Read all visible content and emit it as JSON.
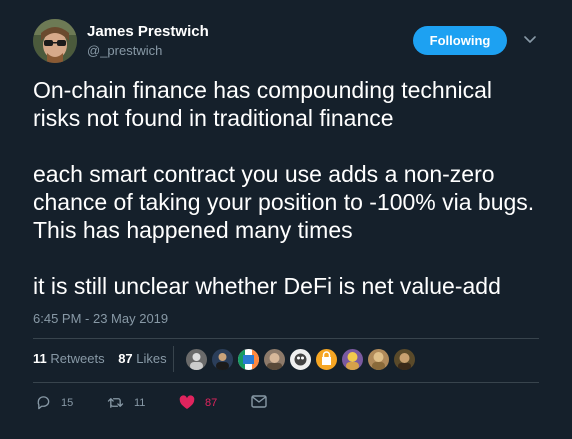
{
  "author": {
    "name": "James Prestwich",
    "handle": "@_prestwich"
  },
  "follow_label": "Following",
  "tweet": {
    "paragraphs": [
      "On-chain finance has compounding technical risks not found in traditional finance",
      "each smart contract you use adds a non-zero chance of taking your position to -100% via bugs. This has happened many times",
      "it is still unclear whether DeFi is net value-add"
    ],
    "timestamp": "6:45 PM - 23 May 2019"
  },
  "stats": {
    "retweets_count": "11",
    "retweets_label": "Retweets",
    "likes_count": "87",
    "likes_label": "Likes"
  },
  "actions": {
    "replies": "15",
    "retweets": "11",
    "likes": "87"
  },
  "colors": {
    "background": "#15202b",
    "accent": "#1da1f2",
    "like": "#e0245e",
    "muted": "#8899a6",
    "divider": "#38444d"
  },
  "icons": [
    "chevron-down-icon",
    "reply-icon",
    "retweet-icon",
    "heart-icon",
    "dm-icon"
  ]
}
